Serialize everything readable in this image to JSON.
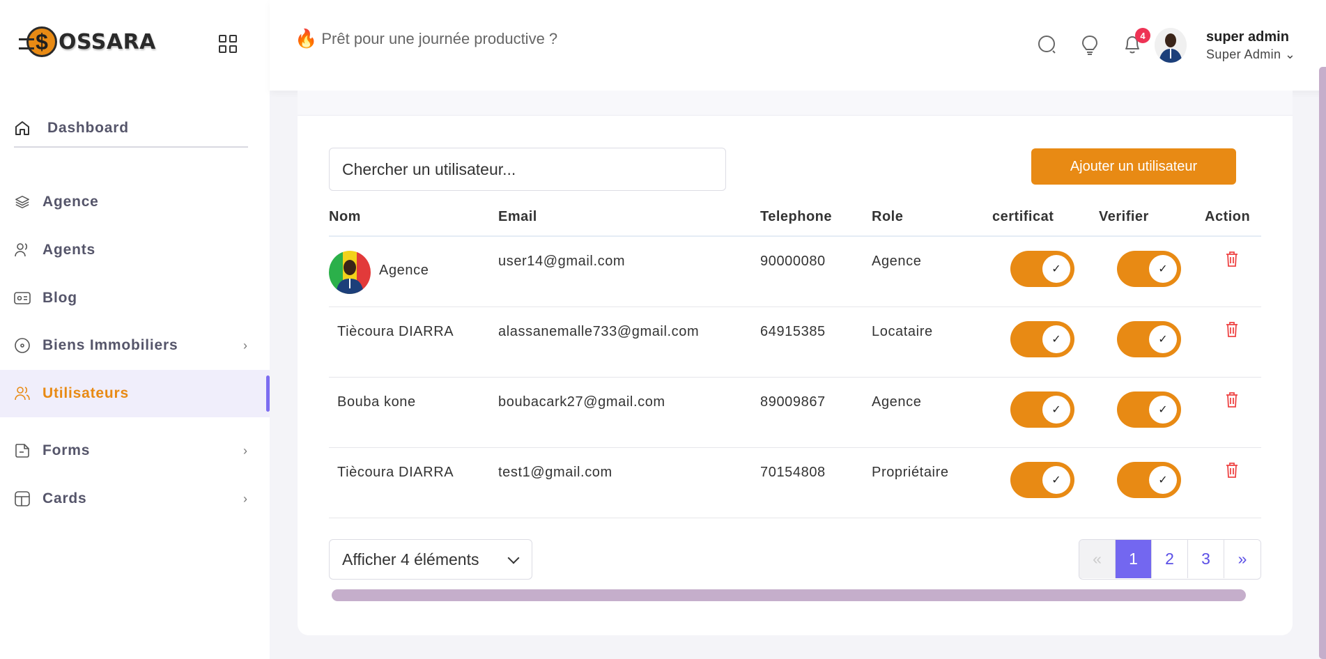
{
  "brand": {
    "logo_text": "OSSARA",
    "logo_coin": "$"
  },
  "header": {
    "greeting": "Prêt pour une journée productive ?",
    "notification_count": "4",
    "user_name": "super admin",
    "user_role": "Super Admin ⌄"
  },
  "sidebar": {
    "items": [
      {
        "label": "Dashboard",
        "icon": "home-icon"
      },
      {
        "label": "Agence",
        "icon": "layers-icon"
      },
      {
        "label": "Agents",
        "icon": "users-icon"
      },
      {
        "label": "Blog",
        "icon": "id-card-icon"
      },
      {
        "label": "Biens Immobiliers",
        "icon": "disc-icon"
      },
      {
        "label": "Utilisateurs",
        "icon": "users-icon",
        "active": true
      },
      {
        "label": "Forms",
        "icon": "file-icon"
      },
      {
        "label": "Cards",
        "icon": "layout-icon"
      }
    ]
  },
  "main": {
    "search_placeholder": "Chercher un utilisateur...",
    "add_button": "Ajouter un utilisateur",
    "columns": [
      "Nom",
      "Email",
      "Telephone",
      "Role",
      "certificat",
      "Verifier",
      "Action"
    ],
    "rows": [
      {
        "nom": "Agence",
        "email": "user14@gmail.com",
        "telephone": "90000080",
        "role": "Agence",
        "certificat": true,
        "verifier": true
      },
      {
        "nom": "Tiècoura DIARRA",
        "email": "alassanemalle733@gmail.com",
        "telephone": "64915385",
        "role": "Locataire",
        "certificat": true,
        "verifier": true
      },
      {
        "nom": "Bouba kone",
        "email": "boubacark27@gmail.com",
        "telephone": "89009867",
        "role": "Agence",
        "certificat": true,
        "verifier": true
      },
      {
        "nom": "Tiècoura DIARRA",
        "email": "test1@gmail.com",
        "telephone": "70154808",
        "role": "Propriétaire",
        "certificat": true,
        "verifier": true
      }
    ],
    "page_size_label": "Afficher 4 éléments",
    "pagination": {
      "prev": "«",
      "pages": [
        "1",
        "2",
        "3"
      ],
      "current": "1",
      "next": "»"
    }
  },
  "colors": {
    "accent": "#e88a14",
    "primary": "#7367f0",
    "danger": "#ee4444",
    "scrollbar": "#c5aecb"
  }
}
